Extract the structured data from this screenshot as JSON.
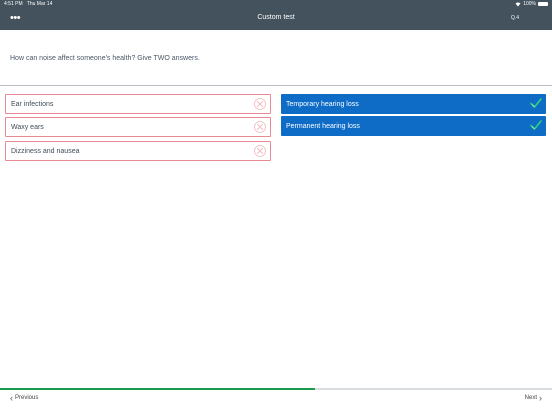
{
  "status_bar": {
    "time": "4:51 PM",
    "date": "Thu Mar 14",
    "battery": "100%"
  },
  "header": {
    "menu_icon": "ellipsis-icon",
    "title": "Custom test",
    "question_number": "Q.4"
  },
  "question": {
    "text": "How can noise affect someone's health? Give TWO answers."
  },
  "options_left": [
    {
      "label": "Ear infections",
      "status": "incorrect",
      "icon": "cross-icon"
    },
    {
      "label": "Waxy ears",
      "status": "incorrect",
      "icon": "cross-icon"
    },
    {
      "label": "Dizziness and nausea",
      "status": "incorrect",
      "icon": "cross-icon"
    }
  ],
  "options_right": [
    {
      "label": "Temporary hearing loss",
      "status": "correct",
      "icon": "check-icon"
    },
    {
      "label": "Permanent hearing loss",
      "status": "correct",
      "icon": "check-icon"
    }
  ],
  "progress": {
    "fraction": 0.57
  },
  "footer": {
    "previous_label": "Previous",
    "next_label": "Next"
  },
  "colors": {
    "header_bg": "#43525c",
    "selected_bg": "#0e6cc7",
    "incorrect_border": "#e88a94",
    "correct_check": "#2fd27c",
    "progress_fill": "#1a9b4f"
  }
}
